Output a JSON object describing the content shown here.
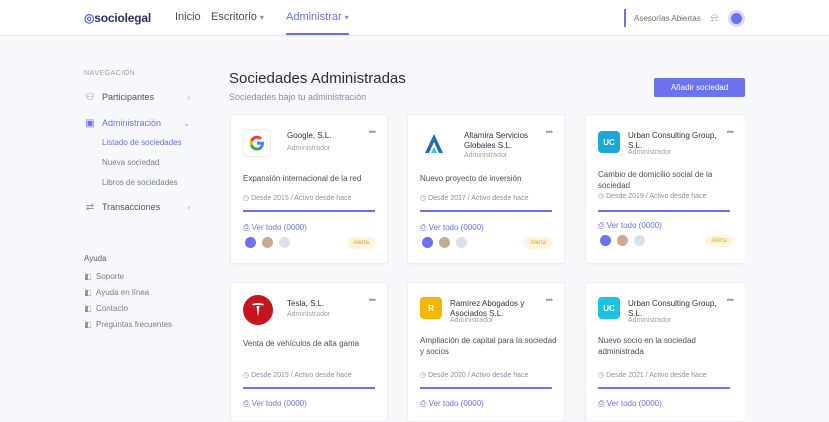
{
  "app": {
    "brand_prefix": "◎",
    "brand": "sociolegal"
  },
  "topnav": {
    "items": [
      "Inicio",
      "Escritorio",
      "Administrar"
    ],
    "active": "Administrar",
    "right_link": "Asesorías Abiertas",
    "bell_icon": "bell-icon"
  },
  "sidebar": {
    "section_title": "NAVEGACIÓN",
    "items": [
      {
        "icon": "users-icon",
        "label": "Participantes"
      },
      {
        "icon": "briefcase-icon",
        "label": "Administración"
      },
      {
        "icon": "chart-icon",
        "label": "Transacciones"
      }
    ],
    "subitems": [
      "Listado de sociedades",
      "Nueva sociedad",
      "Libros de sociedades"
    ],
    "help_title": "Ayuda",
    "help_items": [
      "Soporte",
      "Ayuda en línea",
      "Contacto",
      "Preguntas frecuentes"
    ]
  },
  "main": {
    "title": "Sociedades Administradas",
    "subtitle": "Sociedades bajo tu administración",
    "add_button": "Añadir sociedad"
  },
  "cards": [
    {
      "logo_text": "G",
      "logo_color": "#ffffff",
      "name": "Google, S.L.",
      "role": "Administrador",
      "description": "Expansión internacional de la red",
      "date": "Desde 2015 / Activo desde hace",
      "doc": "Ver todo (0000)",
      "badge": "Alerta"
    },
    {
      "logo_text": "A",
      "logo_color": "#ffffff",
      "name": "Altamira Servicios Globales S.L.",
      "role": "Administrador",
      "description": "Nuevo proyecto de inversión",
      "date": "Desde 2017 / Activo desde hace",
      "doc": "Ver todo (0000)",
      "badge": "Alerta"
    },
    {
      "logo_text": "UC",
      "logo_color": "#1aa8d8",
      "name": "Urban Consulting Group, S.L.",
      "role": "Administrador",
      "description": "Cambio de domicilio social de la sociedad",
      "date": "Desde 2019 / Activo desde hace",
      "doc": "Ver todo (0000)",
      "badge": "Alerta"
    },
    {
      "logo_text": "T",
      "logo_color": "#c4161c",
      "name": "Tesla, S.L.",
      "role": "Administrador",
      "description": "Venta de vehículos de alta gama",
      "date": "Desde 2019 / Activo desde hace",
      "doc": "Ver todo (0000)",
      "badge": ""
    },
    {
      "logo_text": "R",
      "logo_color": "#f5b800",
      "name": "Ramírez Abogados y Asociados S.L.",
      "role": "Administrador",
      "description": "Ampliación de capital para la sociedad y socios",
      "date": "Desde 2020 / Activo desde hace",
      "doc": "Ver todo (0000)",
      "badge": ""
    },
    {
      "logo_text": "UC",
      "logo_color": "#1ac4e0",
      "name": "Urban Consulting Group, S.L.",
      "role": "Administrador",
      "description": "Nuevo socio en la sociedad administrada",
      "date": "Desde 2021 / Activo desde hace",
      "doc": "Ver todo (0000)",
      "badge": ""
    }
  ],
  "colors": {
    "accent": "#6a72f0",
    "badge_bg": "#fff4de",
    "badge_text": "#e4a23a"
  }
}
